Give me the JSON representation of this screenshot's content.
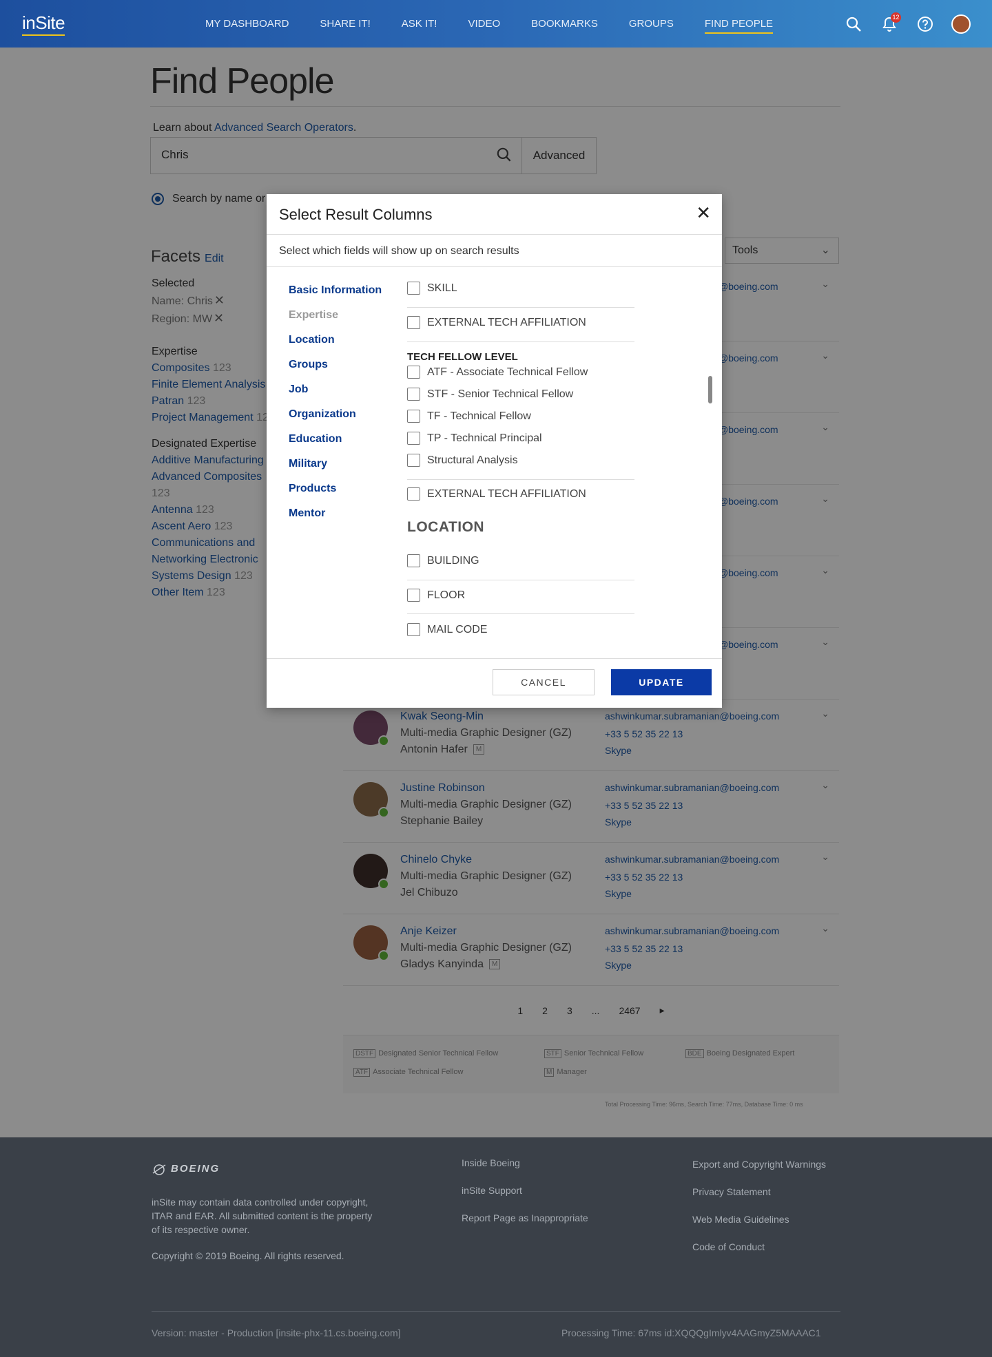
{
  "header": {
    "logo": "inSite",
    "nav": [
      "MY DASHBOARD",
      "SHARE IT!",
      "ASK IT!",
      "VIDEO",
      "BOOKMARKS",
      "GROUPS",
      "FIND PEOPLE"
    ],
    "active_nav": "FIND PEOPLE",
    "notification_count": "12"
  },
  "page": {
    "title": "Find People",
    "learn_prefix": "Learn about ",
    "learn_link": "Advanced Search Operators",
    "learn_suffix": ".",
    "search_value": "Chris",
    "advanced_label": "Advanced",
    "radio_label": "Search by name or"
  },
  "facets": {
    "title": "Facets",
    "edit": "Edit",
    "selected_hd": "Selected",
    "selected": [
      {
        "key": "Name:",
        "val": "Chris"
      },
      {
        "key": "Region:",
        "val": "MW"
      }
    ],
    "expertise_hd": "Expertise",
    "expertise": [
      {
        "label": "Composites",
        "count": "123"
      },
      {
        "label": "Finite Element Analysis",
        "count": ""
      },
      {
        "label": "Patran",
        "count": "123"
      },
      {
        "label": "Project Management",
        "count": "12"
      }
    ],
    "designated_hd": "Designated Expertise",
    "designated": [
      {
        "label": "Additive Manufacturing",
        "count": ""
      },
      {
        "label": "Advanced Composites",
        "count": "123"
      },
      {
        "label": "Antenna",
        "count": "123"
      },
      {
        "label": "Ascent Aero",
        "count": "123"
      },
      {
        "label": "Communications and Networking Electronic Systems Design",
        "count": "123"
      },
      {
        "label": "Other Item",
        "count": "123"
      }
    ]
  },
  "tools_label": "Tools",
  "partial_emails": [
    "@boeing.com",
    "@boeing.com",
    "@boeing.com",
    "@boeing.com",
    "@boeing.com",
    "@boeing.com"
  ],
  "results": [
    {
      "name": "Kwak Seong-Min",
      "role": "Multi-media Graphic Designer (GZ)",
      "manager": "Antonin Hafer",
      "mtag": "M",
      "email": "ashwinkumar.subramanian@boeing.com",
      "phone": "+33 5 52 35 22 13",
      "skype": "Skype"
    },
    {
      "name": "Justine Robinson",
      "role": "Multi-media Graphic Designer (GZ)",
      "manager": "Stephanie Bailey",
      "mtag": "",
      "email": "ashwinkumar.subramanian@boeing.com",
      "phone": "+33 5 52 35 22 13",
      "skype": "Skype"
    },
    {
      "name": "Chinelo Chyke",
      "role": "Multi-media Graphic Designer (GZ)",
      "manager": "Jel Chibuzo",
      "mtag": "",
      "email": "ashwinkumar.subramanian@boeing.com",
      "phone": "+33 5 52 35 22 13",
      "skype": "Skype"
    },
    {
      "name": "Anje Keizer",
      "role": "Multi-media Graphic Designer (GZ)",
      "manager": "Gladys Kanyinda",
      "mtag": "M",
      "email": "ashwinkumar.subramanian@boeing.com",
      "phone": "+33 5 52 35 22 13",
      "skype": "Skype"
    }
  ],
  "pager": [
    "1",
    "2",
    "3",
    "...",
    "2467"
  ],
  "legend": [
    {
      "tag": "DSTF",
      "label": "Designated Senior Technical Fellow"
    },
    {
      "tag": "STF",
      "label": "Senior Technical Fellow"
    },
    {
      "tag": "BDE",
      "label": "Boeing Designated Expert"
    },
    {
      "tag": "ATF",
      "label": "Associate Technical Fellow"
    },
    {
      "tag": "M",
      "label": "Manager"
    }
  ],
  "processing_small": "Total Processing Time: 96ms, Search Time: 77ms, Database Time: 0 ms",
  "modal": {
    "title": "Select Result Columns",
    "subtitle": "Select which fields will show up on search results",
    "nav": [
      "Basic Information",
      "Expertise",
      "Location",
      "Groups",
      "Job",
      "Organization",
      "Education",
      "Military",
      "Products",
      "Mentor"
    ],
    "dim_nav": "Expertise",
    "items": {
      "skill": "SKILL",
      "ext1": "EXTERNAL TECH AFFILIATION",
      "tf_level": "TECH FELLOW LEVEL",
      "atf": "ATF - Associate Technical Fellow",
      "stf": "STF - Senior Technical Fellow",
      "tf": "TF - Technical Fellow",
      "tp": "TP - Technical Principal",
      "sa": "Structural Analysis",
      "ext2": "EXTERNAL TECH AFFILIATION",
      "location": "LOCATION",
      "building": "BUILDING",
      "floor": "FLOOR",
      "mail": "MAIL CODE"
    },
    "cancel": "CANCEL",
    "update": "UPDATE"
  },
  "footer": {
    "logo": "BOEING",
    "disclaimer": "inSite may contain data controlled under copyright, ITAR and EAR. All submitted content is the property of its respective owner.",
    "copyright": "Copyright © 2019 Boeing. All rights reserved.",
    "col1": [
      "Inside Boeing",
      "inSite Support",
      "Report Page as Inappropriate"
    ],
    "col2": [
      "Export and Copyright Warnings",
      "Privacy Statement",
      "Web Media Guidelines",
      "Code of Conduct"
    ],
    "version": "Version: master - Production [insite-phx-11.cs.boeing.com]",
    "processing": "Processing Time: 67ms   id:XQQQgImlyv4AAGmyZ5MAAAC1"
  }
}
